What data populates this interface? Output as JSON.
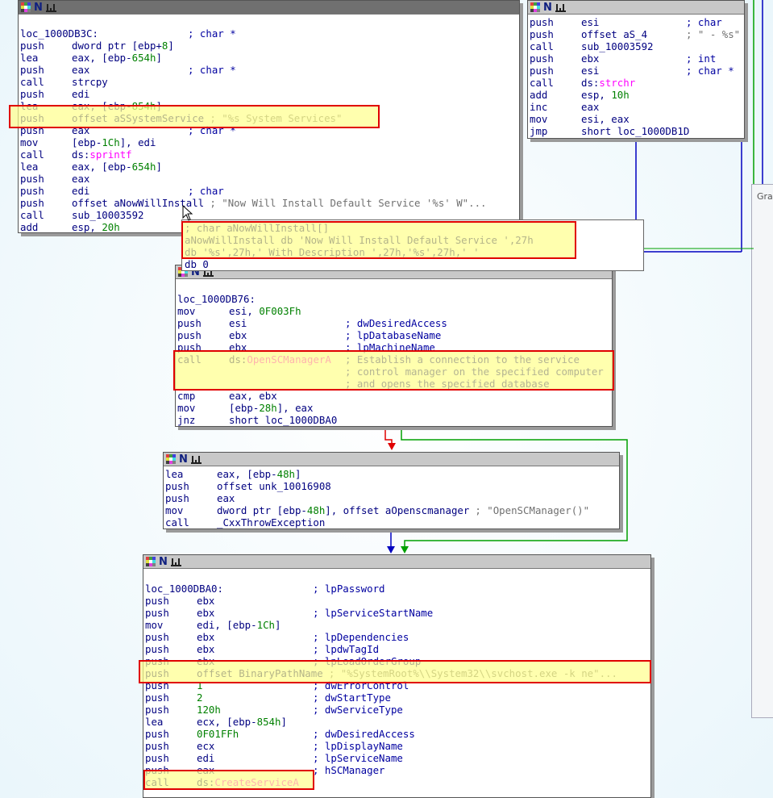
{
  "side_panel": {
    "title": "Gra"
  },
  "colors": {
    "highlight_border": "#e00000",
    "highlight_fill": "#ffff8c",
    "edge_true": "#00a000",
    "edge_false": "#e00000",
    "edge_uncond": "#0000c0"
  },
  "node_a": {
    "lines": [
      {
        "mn": "loc_1000DB3C:",
        "op": "",
        "cm": "; char *"
      },
      {
        "mn": "push",
        "op": "dword ptr [ebp+8]",
        "cm": ""
      },
      {
        "mn": "lea",
        "op": "eax, [ebp-654h]",
        "cm": ""
      },
      {
        "mn": "push",
        "op": "eax",
        "cm": "; char *"
      },
      {
        "mn": "call",
        "op": "strcpy",
        "cm": ""
      },
      {
        "mn": "push",
        "op": "edi",
        "cm": ""
      },
      {
        "mn": "lea",
        "op": "eax, [ebp-854h]",
        "cm": ""
      },
      {
        "mn": "push",
        "op": "offset aSSystemService",
        "cm": "; \"%s System Services\""
      },
      {
        "mn": "push",
        "op": "eax",
        "cm": "; char *"
      },
      {
        "mn": "mov",
        "op": "[ebp-1Ch], edi",
        "cm": ""
      },
      {
        "mn": "call",
        "op": "ds:sprintf",
        "cm": ""
      },
      {
        "mn": "lea",
        "op": "eax, [ebp-654h]",
        "cm": ""
      },
      {
        "mn": "push",
        "op": "eax",
        "cm": ""
      },
      {
        "mn": "push",
        "op": "edi",
        "cm": "; char"
      },
      {
        "mn": "push",
        "op": "offset aNowWillInstall",
        "cm": "; \"Now Will Install Default Service '%s' W\"..."
      },
      {
        "mn": "call",
        "op": "sub_10003592",
        "cm": ""
      },
      {
        "mn": "add",
        "op": "esp, 20h",
        "cm": ""
      }
    ]
  },
  "node_b": {
    "lines": [
      {
        "mn": "push",
        "op": "esi",
        "cm": "; char"
      },
      {
        "mn": "push",
        "op": "offset aS_4",
        "cm": "; \" - %s\""
      },
      {
        "mn": "call",
        "op": "sub_10003592",
        "cm": ""
      },
      {
        "mn": "push",
        "op": "ebx",
        "cm": "; int"
      },
      {
        "mn": "push",
        "op": "esi",
        "cm": "; char *"
      },
      {
        "mn": "call",
        "op": "ds:strchr",
        "cm": ""
      },
      {
        "mn": "add",
        "op": "esp, 10h",
        "cm": ""
      },
      {
        "mn": "inc",
        "op": "eax",
        "cm": ""
      },
      {
        "mn": "mov",
        "op": "esi, eax",
        "cm": ""
      },
      {
        "mn": "jmp",
        "op": "short loc_1000DB1D",
        "cm": ""
      }
    ]
  },
  "tooltip": {
    "lines": [
      "; char aNowWillInstall[]",
      "aNowWillInstall db 'Now Will Install Default Service ',27h",
      "db '%s',27h,' With Description ',27h,'%s',27h,' '",
      "db 0"
    ]
  },
  "node_c": {
    "lines": [
      {
        "mn": "loc_1000DB76:",
        "op": "",
        "cm": ""
      },
      {
        "mn": "mov",
        "op": "esi, 0F003Fh",
        "cm": ""
      },
      {
        "mn": "push",
        "op": "esi",
        "cm": "; dwDesiredAccess"
      },
      {
        "mn": "push",
        "op": "ebx",
        "cm": "; lpDatabaseName"
      },
      {
        "mn": "push",
        "op": "ebx",
        "cm": "; lpMachineName"
      },
      {
        "mn": "call",
        "op": "ds:OpenSCManagerA",
        "cm": "; Establish a connection to the service"
      },
      {
        "mn": "",
        "op": "",
        "cm": "; control manager on the specified computer"
      },
      {
        "mn": "",
        "op": "",
        "cm": "; and opens the specified database"
      },
      {
        "mn": "cmp",
        "op": "eax, ebx",
        "cm": ""
      },
      {
        "mn": "mov",
        "op": "[ebp-28h], eax",
        "cm": ""
      },
      {
        "mn": "jnz",
        "op": "short loc_1000DBA0",
        "cm": ""
      }
    ]
  },
  "node_d": {
    "lines": [
      {
        "mn": "lea",
        "op": "eax, [ebp-48h]",
        "cm": ""
      },
      {
        "mn": "push",
        "op": "offset unk_10016908",
        "cm": ""
      },
      {
        "mn": "push",
        "op": "eax",
        "cm": ""
      },
      {
        "mn": "mov",
        "op": "dword ptr [ebp-48h], offset aOpenscmanager",
        "cm": "; \"OpenSCManager()\""
      },
      {
        "mn": "call",
        "op": "_CxxThrowException",
        "cm": ""
      }
    ]
  },
  "node_e": {
    "lines": [
      {
        "mn": "loc_1000DBA0:",
        "op": "",
        "cm": "; lpPassword"
      },
      {
        "mn": "push",
        "op": "ebx",
        "cm": ""
      },
      {
        "mn": "push",
        "op": "ebx",
        "cm": "; lpServiceStartName"
      },
      {
        "mn": "mov",
        "op": "edi, [ebp-1Ch]",
        "cm": ""
      },
      {
        "mn": "push",
        "op": "ebx",
        "cm": "; lpDependencies"
      },
      {
        "mn": "push",
        "op": "ebx",
        "cm": "; lpdwTagId"
      },
      {
        "mn": "push",
        "op": "ebx",
        "cm": "; lpLoadOrderGroup"
      },
      {
        "mn": "push",
        "op": "offset BinaryPathName",
        "cm": "; \"%SystemRoot%\\\\System32\\\\svchost.exe -k ne\"..."
      },
      {
        "mn": "push",
        "op": "1",
        "cm": "; dwErrorControl"
      },
      {
        "mn": "push",
        "op": "2",
        "cm": "; dwStartType"
      },
      {
        "mn": "push",
        "op": "120h",
        "cm": "; dwServiceType"
      },
      {
        "mn": "lea",
        "op": "ecx, [ebp-854h]",
        "cm": ""
      },
      {
        "mn": "push",
        "op": "0F01FFh",
        "cm": "; dwDesiredAccess"
      },
      {
        "mn": "push",
        "op": "ecx",
        "cm": "; lpDisplayName"
      },
      {
        "mn": "push",
        "op": "edi",
        "cm": "; lpServiceName"
      },
      {
        "mn": "push",
        "op": "eax",
        "cm": "; hSCManager"
      },
      {
        "mn": "call",
        "op": "ds:CreateServiceA",
        "cm": ""
      }
    ]
  }
}
